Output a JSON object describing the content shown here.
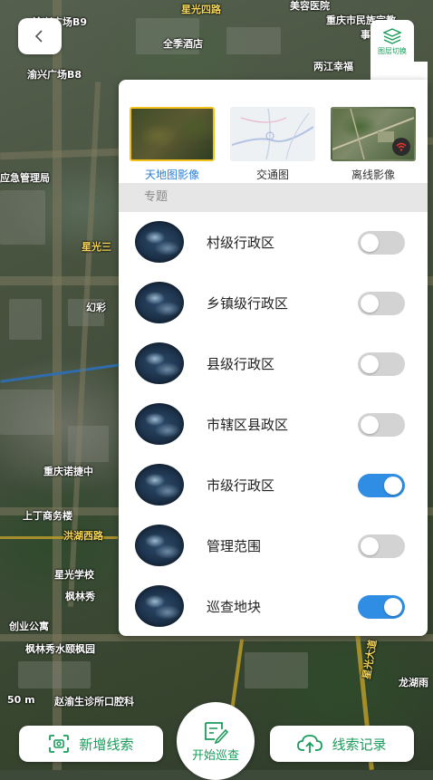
{
  "map": {
    "labels": [
      {
        "text": "星光四路",
        "style": "y"
      },
      {
        "text": "重庆市民族宗教",
        "style": ""
      },
      {
        "text": "事",
        "style": ""
      },
      {
        "text": "渝兴广场B9",
        "style": ""
      },
      {
        "text": "全季酒店",
        "style": ""
      },
      {
        "text": "两江幸福",
        "style": ""
      },
      {
        "text": "渝兴广场B8",
        "style": ""
      },
      {
        "text": "应急管理局",
        "style": ""
      },
      {
        "text": "星光三",
        "style": "g"
      },
      {
        "text": "幻彩",
        "style": ""
      },
      {
        "text": "重庆诺捷中",
        "style": ""
      },
      {
        "text": "上丁商务楼",
        "style": ""
      },
      {
        "text": "洪湖西路",
        "style": "y"
      },
      {
        "text": "星光学校",
        "style": ""
      },
      {
        "text": "枫林秀",
        "style": ""
      },
      {
        "text": "创业公寓",
        "style": ""
      },
      {
        "text": "枫林秀水颐枫园",
        "style": ""
      },
      {
        "text": "50 m",
        "style": ""
      },
      {
        "text": "赵渝生诊所口腔科",
        "style": ""
      },
      {
        "text": "龙湖雨",
        "style": ""
      },
      {
        "text": "星光大道",
        "style": "y"
      },
      {
        "text": "美容医院",
        "style": ""
      }
    ]
  },
  "back_button": {
    "icon": "chevron-left-icon"
  },
  "layer_toggle": {
    "label": "图层切换",
    "icon": "layers-icon"
  },
  "basemaps": [
    {
      "label": "天地图影像",
      "selected": true
    },
    {
      "label": "交通图",
      "selected": false
    },
    {
      "label": "离线影像",
      "selected": false
    }
  ],
  "section_title": "专题",
  "layers": [
    {
      "name": "村级行政区",
      "on": false
    },
    {
      "name": "乡镇级行政区",
      "on": false
    },
    {
      "name": "县级行政区",
      "on": false
    },
    {
      "name": "市辖区县政区",
      "on": false
    },
    {
      "name": "市级行政区",
      "on": true
    },
    {
      "name": "管理范围",
      "on": false
    },
    {
      "name": "巡查地块",
      "on": true
    }
  ],
  "bottom": {
    "add_clue": "新增线索",
    "start_patrol": "开始巡查",
    "clue_records": "线索记录"
  },
  "colors": {
    "accent": "#1a9c5b",
    "toggle_on": "#2f8de4",
    "selected_border": "#f2c21a"
  }
}
